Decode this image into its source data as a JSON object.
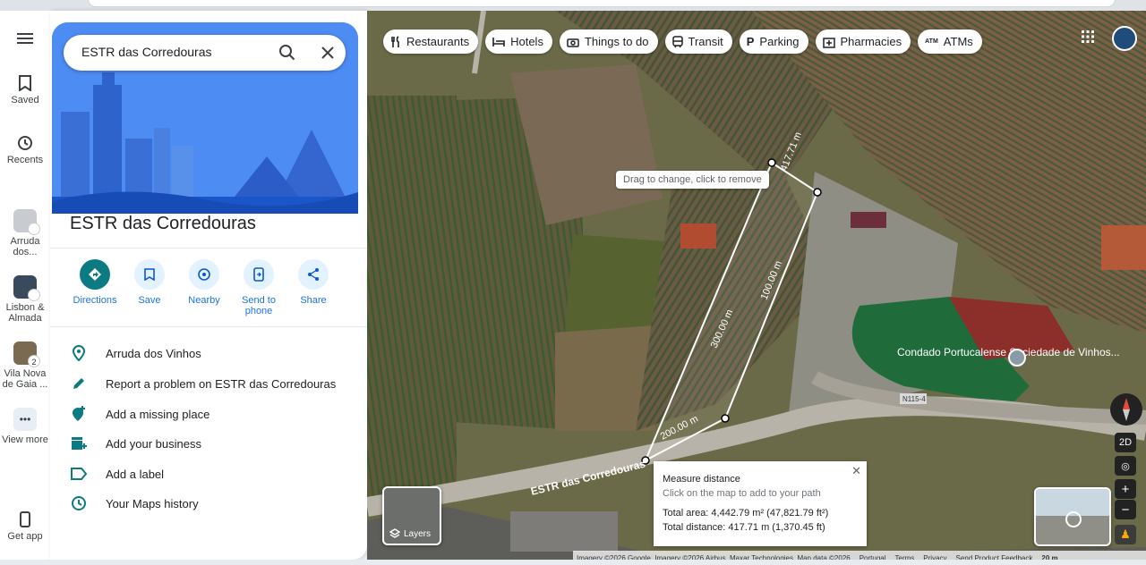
{
  "rail": {
    "menu_icon": "hamburger-icon",
    "saved": "Saved",
    "recents": "Recents",
    "recent_places": [
      {
        "label": "Arruda dos...",
        "badge": ""
      },
      {
        "label": "Lisbon & Almada",
        "badge": ""
      },
      {
        "label": "Vila Nova de Gaia ...",
        "badge": "2"
      }
    ],
    "view_more": "View more",
    "get_app": "Get app"
  },
  "panel": {
    "search_value": "ESTR das Corredouras",
    "place_title": "ESTR das Corredouras",
    "actions": [
      {
        "label": "Directions",
        "icon": "directions-icon"
      },
      {
        "label": "Save",
        "icon": "bookmark-icon"
      },
      {
        "label": "Nearby",
        "icon": "nearby-icon"
      },
      {
        "label": "Send to phone",
        "icon": "send-to-phone-icon"
      },
      {
        "label": "Share",
        "icon": "share-icon"
      }
    ],
    "list": [
      {
        "label": "Arruda dos Vinhos",
        "icon": "location-pin-icon"
      },
      {
        "label": "Report a problem on ESTR das Corredouras",
        "icon": "pencil-icon"
      },
      {
        "label": "Add a missing place",
        "icon": "add-place-icon"
      },
      {
        "label": "Add your business",
        "icon": "add-business-icon"
      },
      {
        "label": "Add a label",
        "icon": "label-icon"
      },
      {
        "label": "Your Maps history",
        "icon": "history-icon"
      }
    ]
  },
  "map": {
    "chips": [
      {
        "label": "Restaurants",
        "icon": "restaurant-icon"
      },
      {
        "label": "Hotels",
        "icon": "hotel-icon"
      },
      {
        "label": "Things to do",
        "icon": "camera-icon"
      },
      {
        "label": "Transit",
        "icon": "transit-icon"
      },
      {
        "label": "Parking",
        "icon": "parking-icon"
      },
      {
        "label": "Pharmacies",
        "icon": "pharmacy-icon"
      },
      {
        "label": "ATMs",
        "icon": "atm-icon"
      }
    ],
    "tooltip": "Drag to change, click to remove",
    "segment_labels": [
      "417.71 m",
      "100.00 m",
      "300.00 m",
      "200.00 m"
    ],
    "road_labels": [
      "ESTR das Corredouras",
      "N115-4"
    ],
    "poi": "Condado Portucalense Sociedade de Vinhos...",
    "measure": {
      "title": "Measure distance",
      "hint": "Click on the map to add to your path",
      "area": "Total area: 4,442.79 m² (47,821.79 ft²)",
      "distance": "Total distance: 417.71 m (1,370.45 ft)"
    },
    "layers_label": "Layers",
    "view_2d": "2D",
    "footer": {
      "imagery": "Imagery ©2026 Google, Imagery ©2026 Airbus, Maxar Technologies, Map data ©2026",
      "country": "Portugal",
      "terms": "Terms",
      "privacy": "Privacy",
      "feedback": "Send Product Feedback",
      "scale": "20 m"
    }
  }
}
